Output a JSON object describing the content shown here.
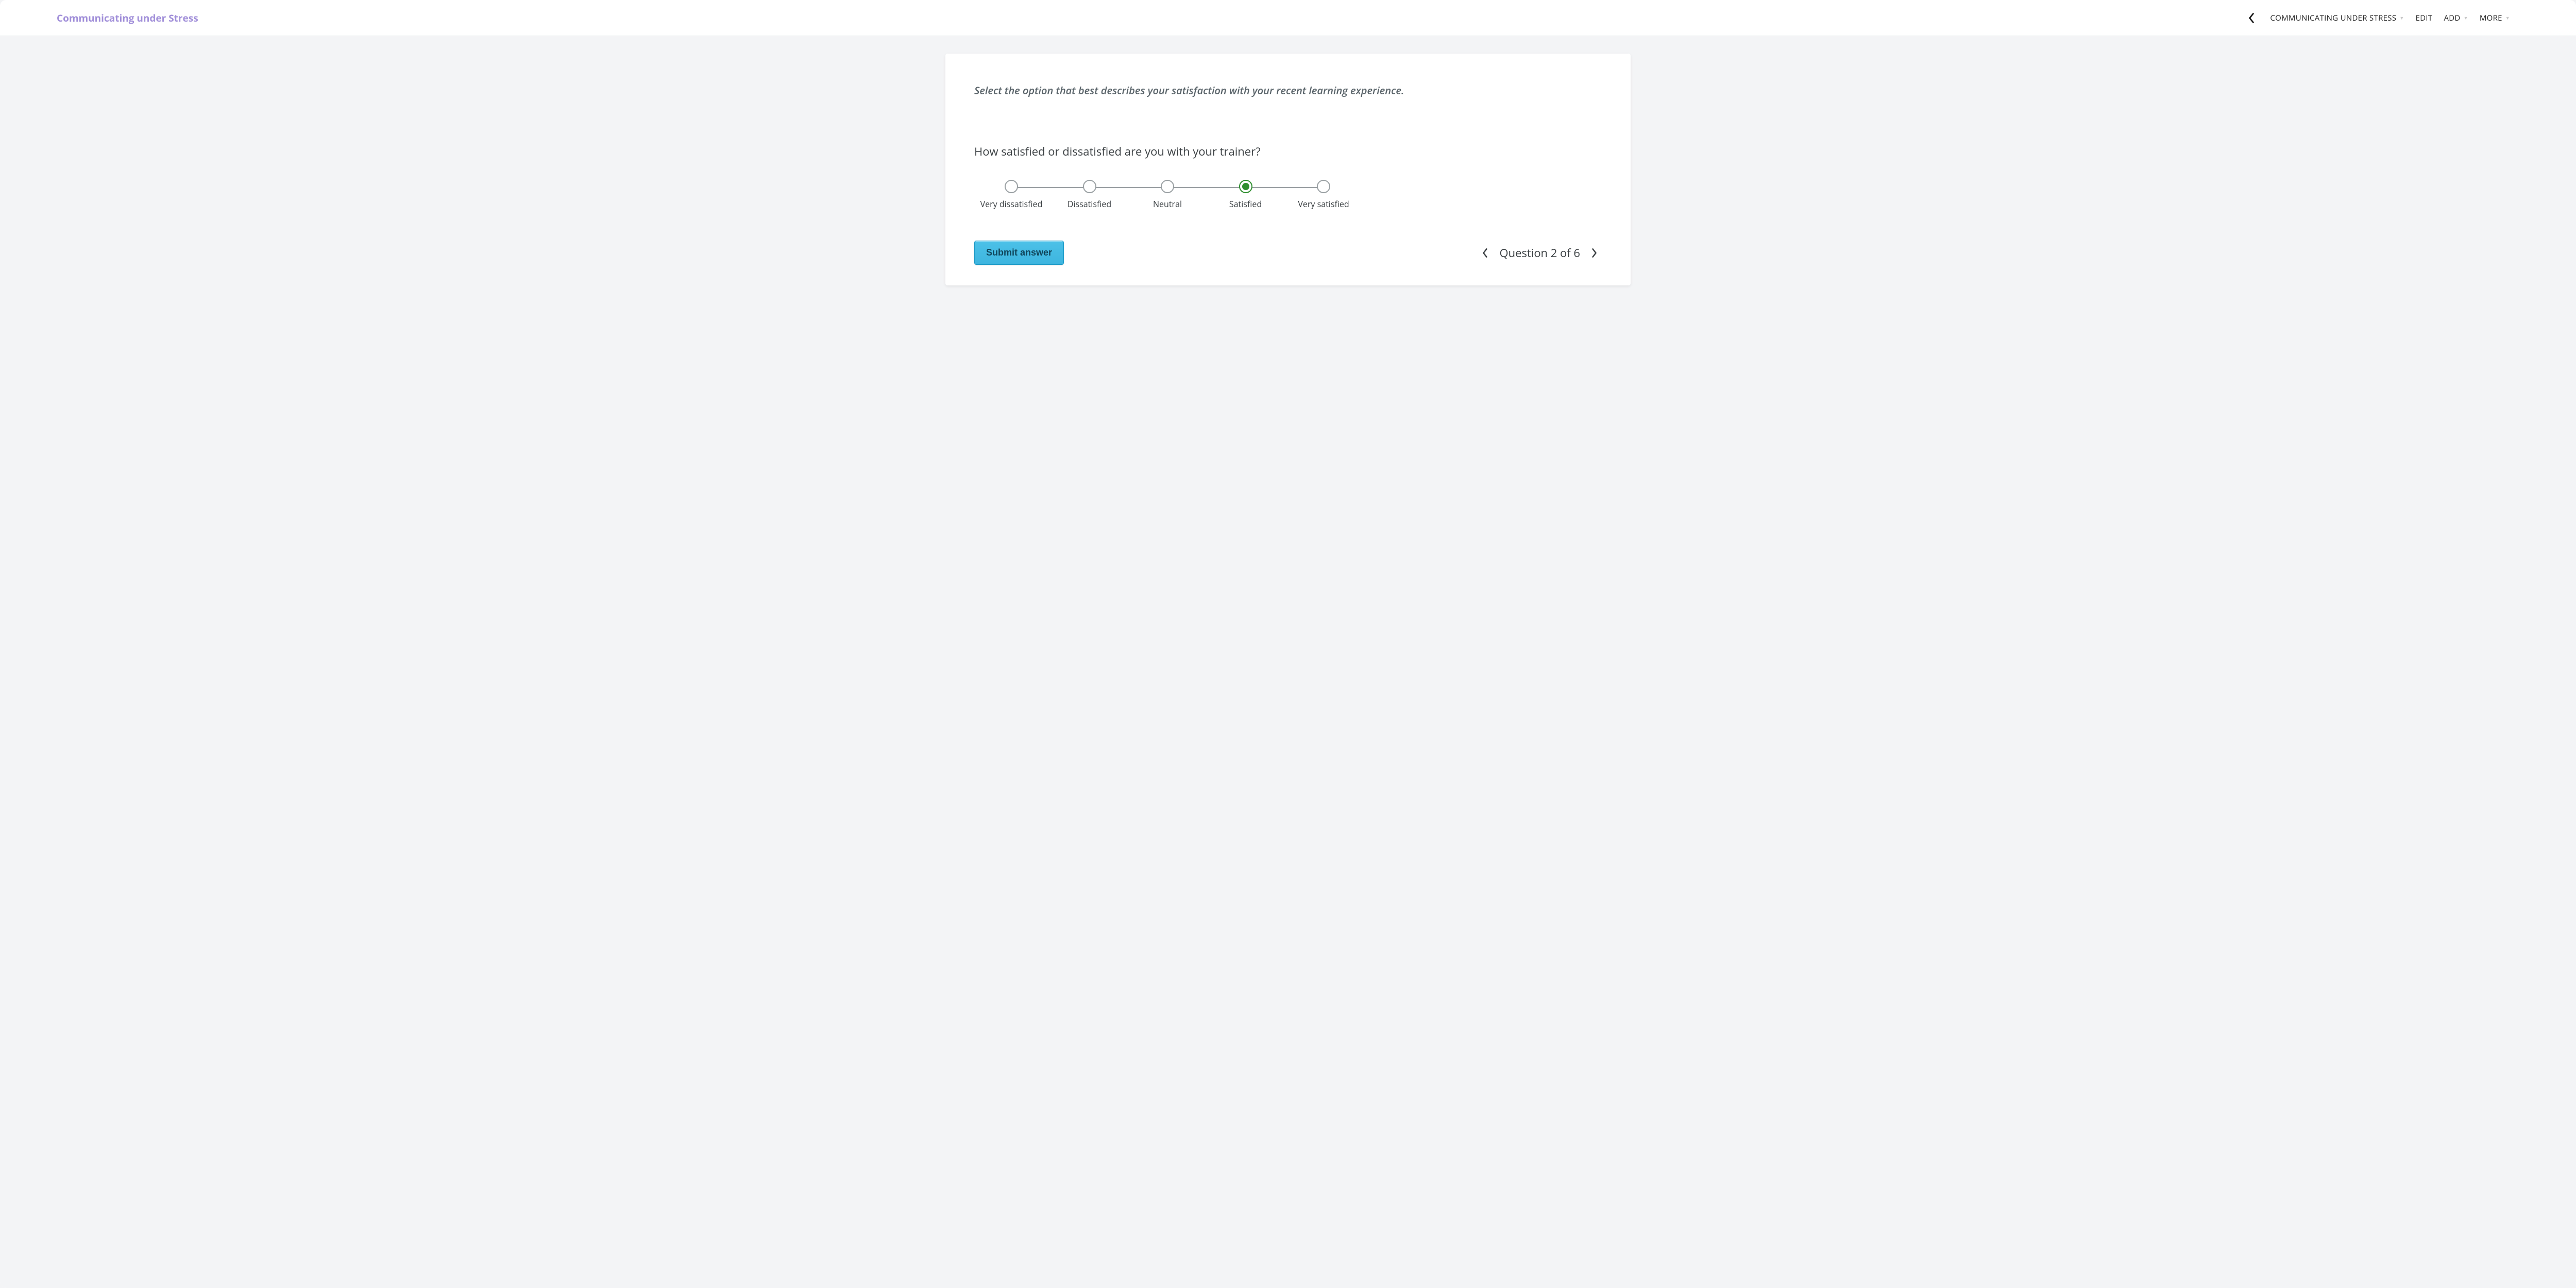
{
  "header": {
    "title": "Communicating under Stress",
    "menu": [
      {
        "label": "COMMUNICATING UNDER STRESS",
        "has_caret": true
      },
      {
        "label": "EDIT",
        "has_caret": false
      },
      {
        "label": "ADD",
        "has_caret": true
      },
      {
        "label": "MORE",
        "has_caret": true
      }
    ]
  },
  "card": {
    "prompt": "Select the option that best describes your satisfaction with your recent learning experience.",
    "question": "How satisfied or dissatisfied are you with your trainer?",
    "likert": {
      "options": [
        "Very dissatisfied",
        "Dissatisfied",
        "Neutral",
        "Satisfied",
        "Very satisfied"
      ],
      "selected_index": 3
    },
    "submit_label": "Submit answer",
    "pager_text": "Question 2 of 6"
  }
}
